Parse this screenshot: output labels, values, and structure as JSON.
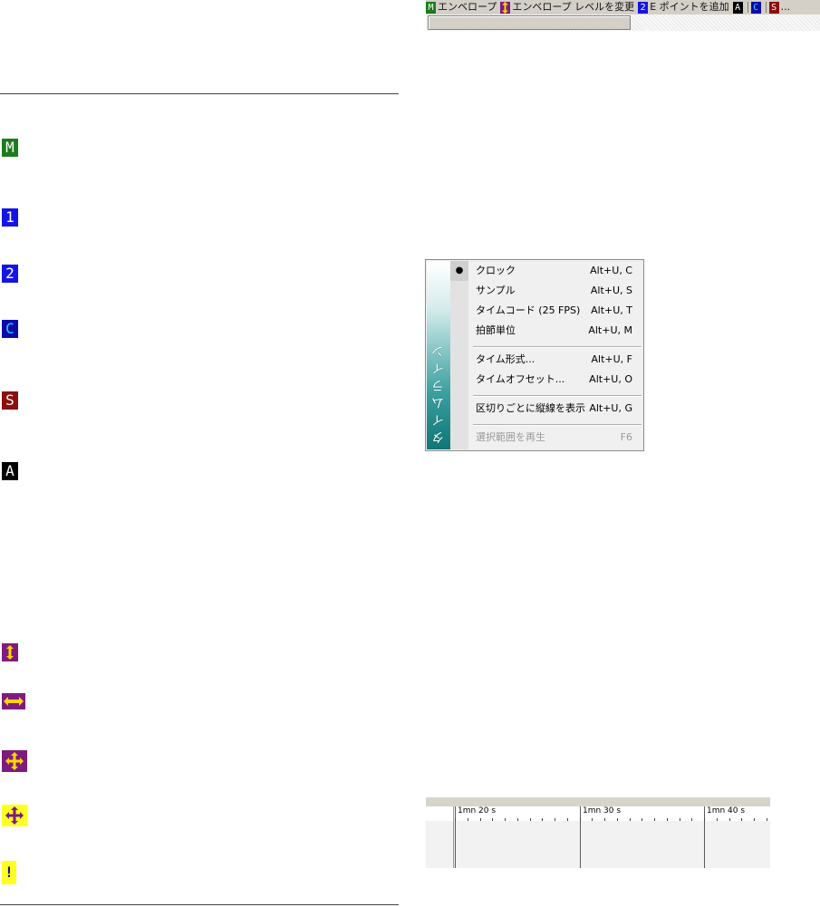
{
  "left_icons": [
    {
      "id": "m",
      "glyph": "M",
      "style": "green"
    },
    {
      "id": "one",
      "glyph": "1",
      "style": "blue"
    },
    {
      "id": "two",
      "glyph": "2",
      "style": "blue"
    },
    {
      "id": "c",
      "glyph": "C",
      "style": "navy"
    },
    {
      "id": "s",
      "glyph": "S",
      "style": "maroon"
    },
    {
      "id": "a",
      "glyph": "A",
      "style": "black"
    },
    {
      "id": "updown",
      "icon": "vertical-arrow-icon"
    },
    {
      "id": "leftright",
      "icon": "horizontal-arrow-icon"
    },
    {
      "id": "move-purple",
      "icon": "move-cross-icon"
    },
    {
      "id": "move-yellow",
      "icon": "move-cross-icon"
    },
    {
      "id": "exclaim",
      "glyph": "!",
      "icon": "exclamation-icon"
    }
  ],
  "statusbar": {
    "m_badge": "M",
    "envelope_label": "エンベロープ",
    "level_label": "エンベロープ レベルを変更",
    "two_badge": "2",
    "add_point_label": "E ポイントを追加",
    "a_badge": "A",
    "c_badge": "C",
    "s_badge": "S",
    "ellipsis": "..."
  },
  "menu": {
    "side_title": "タイムライン",
    "items": [
      {
        "label": "クロック",
        "shortcut": "Alt+U, C",
        "checked": "●"
      },
      {
        "label": "サンプル",
        "shortcut": "Alt+U, S"
      },
      {
        "label": "タイムコード (25 FPS)",
        "shortcut": "Alt+U, T"
      },
      {
        "label": "拍節単位",
        "shortcut": "Alt+U, M"
      },
      {
        "label": "タイム形式...",
        "shortcut": "Alt+U, F"
      },
      {
        "label": "タイムオフセット...",
        "shortcut": "Alt+U, O"
      },
      {
        "label": "区切りごとに縦線を表示",
        "shortcut": "Alt+U, G"
      },
      {
        "label": "選択範囲を再生",
        "shortcut": "F6",
        "disabled": true
      }
    ]
  },
  "ruler": {
    "labels": [
      "1mn 20 s",
      "1mn 30 s",
      "1mn 40 s"
    ]
  },
  "colors": {
    "green": "#1e7a1e",
    "blue": "#1414e6",
    "navy": "#0a0aa8",
    "cyan": "#21d6ff",
    "maroon": "#8b0f0f",
    "purple": "#7e1b7e",
    "yellow": "#ffff20",
    "gold": "#ffd400"
  }
}
